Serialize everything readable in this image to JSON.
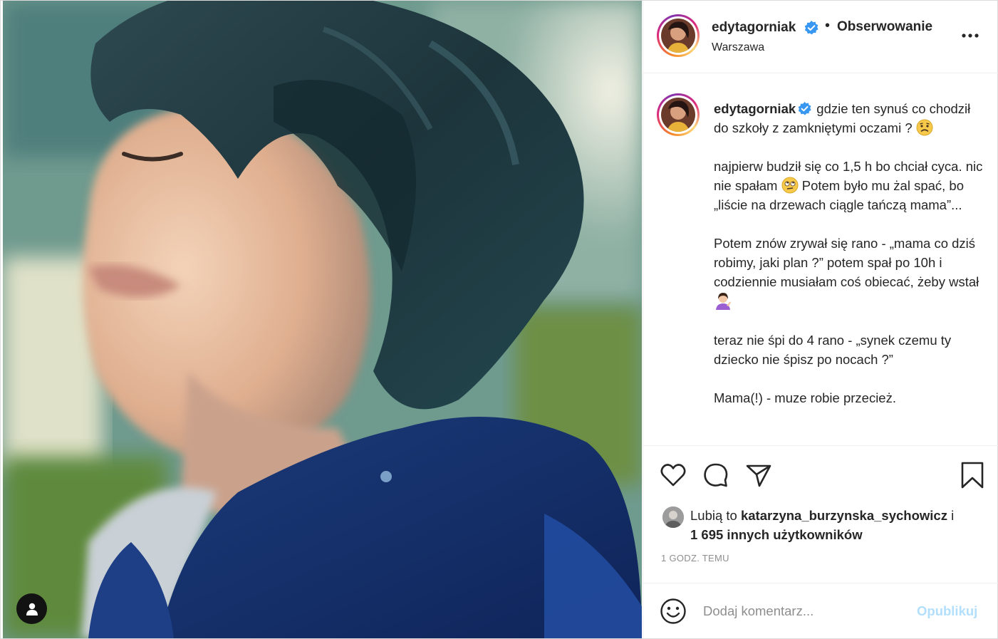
{
  "post": {
    "author": {
      "username": "edytagorniak",
      "verified": true,
      "follow_status": "Obserwowanie",
      "location": "Warszawa",
      "separator": "•"
    },
    "photo": {
      "tag_icon": "user-icon"
    },
    "caption": {
      "username": "edytagorniak",
      "paragraphs": [
        "gdzie ten synuś co chodził do szkoły z zamkniętymi oczami ?",
        "najpierw budził się co 1,5 h bo chciał cyca. nic nie spałam",
        "Potem było mu żal spać, bo „liście na drzewach ciągle tańczą mama”...",
        "Potem znów zrywał się rano - „mama co dziś robimy, jaki plan ?” potem spał po 10h i codziennie musiałam coś obiecać, żeby wstał",
        "teraz nie śpi do 4 rano - „synek czemu ty dziecko nie śpisz po nocach ?”",
        "Mama(!) - muze robie przecież."
      ],
      "emojis": [
        "worried-face-emoji",
        "rolling-eyes-emoji",
        "woman-tipping-hand-emoji"
      ]
    },
    "actions": {
      "like_icon": "heart-icon",
      "comment_icon": "comment-icon",
      "share_icon": "paper-plane-icon",
      "save_icon": "bookmark-icon"
    },
    "likes": {
      "prefix": "Lubią to",
      "user": "katarzyna_burzynska_sychowicz",
      "connector": "i",
      "others": "1 695 innych użytkowników"
    },
    "timestamp": "1 godz. temu",
    "comment_box": {
      "emoji_icon": "smiley-icon",
      "placeholder": "Dodaj komentarz...",
      "publish_label": "Opublikuj",
      "publish_color": "#b2dffc"
    },
    "colors": {
      "verified": "#3897f0",
      "text": "#262626",
      "secondary": "#8e8e8e"
    }
  }
}
